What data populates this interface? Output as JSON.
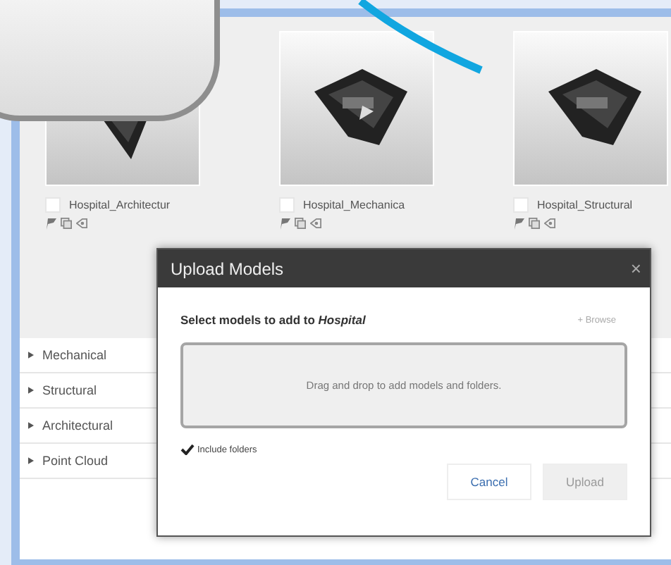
{
  "models": [
    {
      "name": "Hospital_Architectur",
      "checked": false,
      "kind": "picture"
    },
    {
      "name": "Hospital_Mechanica",
      "checked": false,
      "kind": "picture"
    },
    {
      "name": "Hospital_Structural",
      "checked": false,
      "kind": "picture"
    }
  ],
  "tree": [
    {
      "label": "Mechanical",
      "expanded": false
    },
    {
      "label": "Structural",
      "expanded": false
    },
    {
      "label": "Architectural",
      "expanded": false
    },
    {
      "label": "Point Cloud",
      "expanded": false
    }
  ],
  "dialog": {
    "title": "Upload Models",
    "close": "×",
    "prompt": "Select models to add to *Hospital*",
    "browse": "+ Browse",
    "dropzone": "Drag and drop to add models and folders.",
    "include_folders": {
      "label": "Include folders",
      "checked": true
    },
    "buttons": [
      {
        "label": "Cancel",
        "disabled": false
      },
      {
        "label": "Upload",
        "disabled": true
      }
    ]
  }
}
